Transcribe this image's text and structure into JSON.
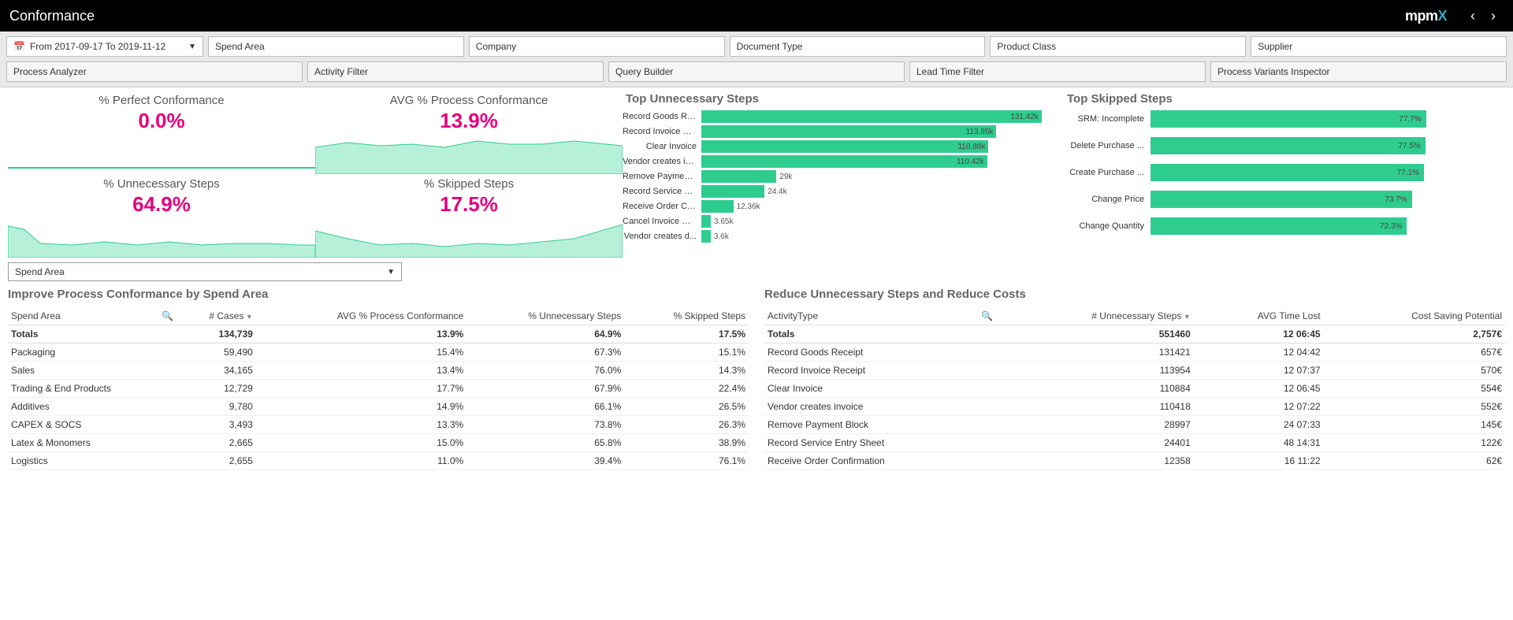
{
  "header": {
    "title": "Conformance",
    "brand1": "mpm",
    "brand2": "X"
  },
  "date_filter": "From 2017-09-17 To 2019-11-12",
  "filters": [
    "Spend Area",
    "Company",
    "Document Type",
    "Product Class",
    "Supplier"
  ],
  "tools": [
    "Process Analyzer",
    "Activity Filter",
    "Query Builder",
    "Lead Time Filter",
    "Process Variants Inspector"
  ],
  "kpis": {
    "perfect": {
      "title": "% Perfect Conformance",
      "value": "0.0%"
    },
    "avgproc": {
      "title": "AVG % Process Conformance",
      "value": "13.9%"
    },
    "unnecessary": {
      "title": "% Unnecessary Steps",
      "value": "64.9%"
    },
    "skipped": {
      "title": "% Skipped Steps",
      "value": "17.5%"
    }
  },
  "chart_data": [
    {
      "type": "bar",
      "orientation": "horizontal",
      "title": "Top Unnecessary Steps",
      "categories": [
        "Record Goods Re...",
        "Record Invoice Re...",
        "Clear Invoice",
        "Vendor creates in...",
        "Remove Payment...",
        "Record Service E...",
        "Receive Order Co...",
        "Cancel Invoice Re...",
        "Vendor creates d..."
      ],
      "values": [
        131420,
        113950,
        110880,
        110420,
        29000,
        24400,
        12360,
        3650,
        3600
      ],
      "labels": [
        "131.42k",
        "113.95k",
        "110.88k",
        "110.42k",
        "29k",
        "24.4k",
        "12.36k",
        "3.65k",
        "3.6k"
      ],
      "xlim": [
        0,
        140000
      ]
    },
    {
      "type": "bar",
      "orientation": "horizontal",
      "title": "Top Skipped Steps",
      "categories": [
        "SRM: Incomplete",
        "Delete Purchase ...",
        "Create Purchase ...",
        "Change Price",
        "Change Quantity"
      ],
      "values": [
        77.7,
        77.5,
        77.1,
        73.7,
        72.3
      ],
      "labels": [
        "77.7%",
        "77.5%",
        "77.1%",
        "73.7%",
        "72.3%"
      ],
      "xlim": [
        0,
        100
      ]
    }
  ],
  "spend_area_selector": "Spend Area",
  "table1": {
    "title": "Improve Process Conformance by Spend Area",
    "headers": [
      "Spend Area",
      "# Cases",
      "AVG % Process Conformance",
      "% Unnecessary Steps",
      "% Skipped Steps"
    ],
    "totals": [
      "Totals",
      "134,739",
      "13.9%",
      "64.9%",
      "17.5%"
    ],
    "rows": [
      [
        "Packaging",
        "59,490",
        "15.4%",
        "67.3%",
        "15.1%"
      ],
      [
        "Sales",
        "34,165",
        "13.4%",
        "76.0%",
        "14.3%"
      ],
      [
        "Trading & End Products",
        "12,729",
        "17.7%",
        "67.9%",
        "22.4%"
      ],
      [
        "Additives",
        "9,780",
        "14.9%",
        "66.1%",
        "26.5%"
      ],
      [
        "CAPEX & SOCS",
        "3,493",
        "13.3%",
        "73.8%",
        "26.3%"
      ],
      [
        "Latex & Monomers",
        "2,665",
        "15.0%",
        "65.8%",
        "38.9%"
      ],
      [
        "Logistics",
        "2,655",
        "11.0%",
        "39.4%",
        "76.1%"
      ]
    ]
  },
  "table2": {
    "title": "Reduce Unnecessary Steps and Reduce Costs",
    "headers": [
      "ActivityType",
      "# Unnecessary Steps",
      "AVG Time Lost",
      "Cost Saving Potential"
    ],
    "totals": [
      "Totals",
      "551460",
      "12 06:45",
      "2,757€"
    ],
    "rows": [
      [
        "Record Goods Receipt",
        "131421",
        "12 04:42",
        "657€"
      ],
      [
        "Record Invoice Receipt",
        "113954",
        "12 07:37",
        "570€"
      ],
      [
        "Clear Invoice",
        "110884",
        "12 06:45",
        "554€"
      ],
      [
        "Vendor creates invoice",
        "110418",
        "12 07:22",
        "552€"
      ],
      [
        "Remove Payment Block",
        "28997",
        "24 07:33",
        "145€"
      ],
      [
        "Record Service Entry Sheet",
        "24401",
        "48 14:31",
        "122€"
      ],
      [
        "Receive Order Confirmation",
        "12358",
        "16 11:22",
        "62€"
      ]
    ]
  }
}
